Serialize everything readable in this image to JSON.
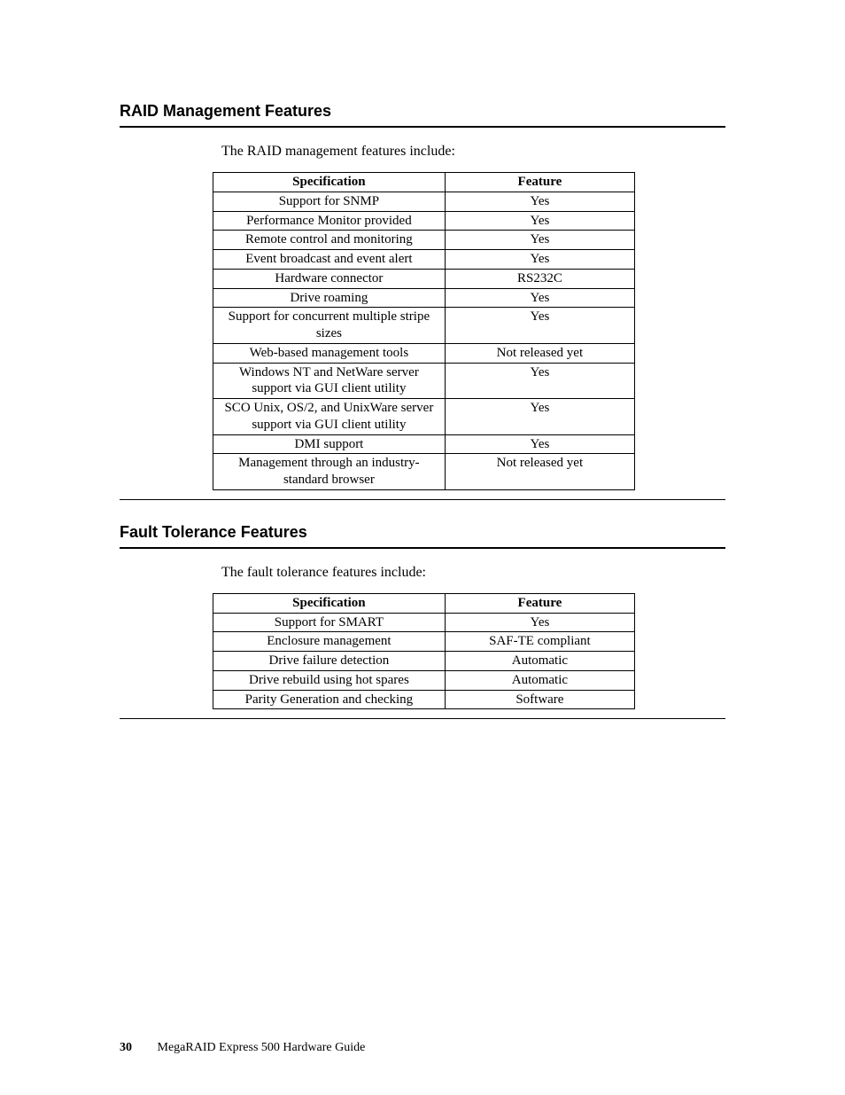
{
  "sections": {
    "raid": {
      "heading": "RAID Management Features",
      "intro": "The RAID management features include:",
      "table": {
        "headers": {
          "spec": "Specification",
          "feat": "Feature"
        },
        "rows": [
          {
            "spec": "Support for SNMP",
            "feat": "Yes"
          },
          {
            "spec": "Performance Monitor provided",
            "feat": "Yes"
          },
          {
            "spec": "Remote control and monitoring",
            "feat": "Yes"
          },
          {
            "spec": "Event broadcast and event alert",
            "feat": "Yes"
          },
          {
            "spec": "Hardware connector",
            "feat": "RS232C"
          },
          {
            "spec": "Drive roaming",
            "feat": "Yes"
          },
          {
            "spec": "Support for concurrent multiple stripe sizes",
            "feat": "Yes"
          },
          {
            "spec": "Web-based management tools",
            "feat": "Not released yet"
          },
          {
            "spec": "Windows NT and NetWare server support via GUI client utility",
            "feat": "Yes"
          },
          {
            "spec": "SCO Unix, OS/2, and UnixWare server support via GUI client utility",
            "feat": "Yes"
          },
          {
            "spec": "DMI support",
            "feat": "Yes"
          },
          {
            "spec": "Management through an industry-standard browser",
            "feat": "Not released yet"
          }
        ]
      }
    },
    "fault": {
      "heading": "Fault Tolerance Features",
      "intro": "The fault tolerance features include:",
      "table": {
        "headers": {
          "spec": "Specification",
          "feat": "Feature"
        },
        "rows": [
          {
            "spec": "Support for SMART",
            "feat": "Yes"
          },
          {
            "spec": "Enclosure management",
            "feat": "SAF-TE compliant"
          },
          {
            "spec": "Drive failure detection",
            "feat": "Automatic"
          },
          {
            "spec": "Drive rebuild using hot spares",
            "feat": "Automatic"
          },
          {
            "spec": "Parity Generation and checking",
            "feat": "Software"
          }
        ]
      }
    }
  },
  "footer": {
    "page_number": "30",
    "doc_title": "MegaRAID Express 500 Hardware Guide"
  }
}
